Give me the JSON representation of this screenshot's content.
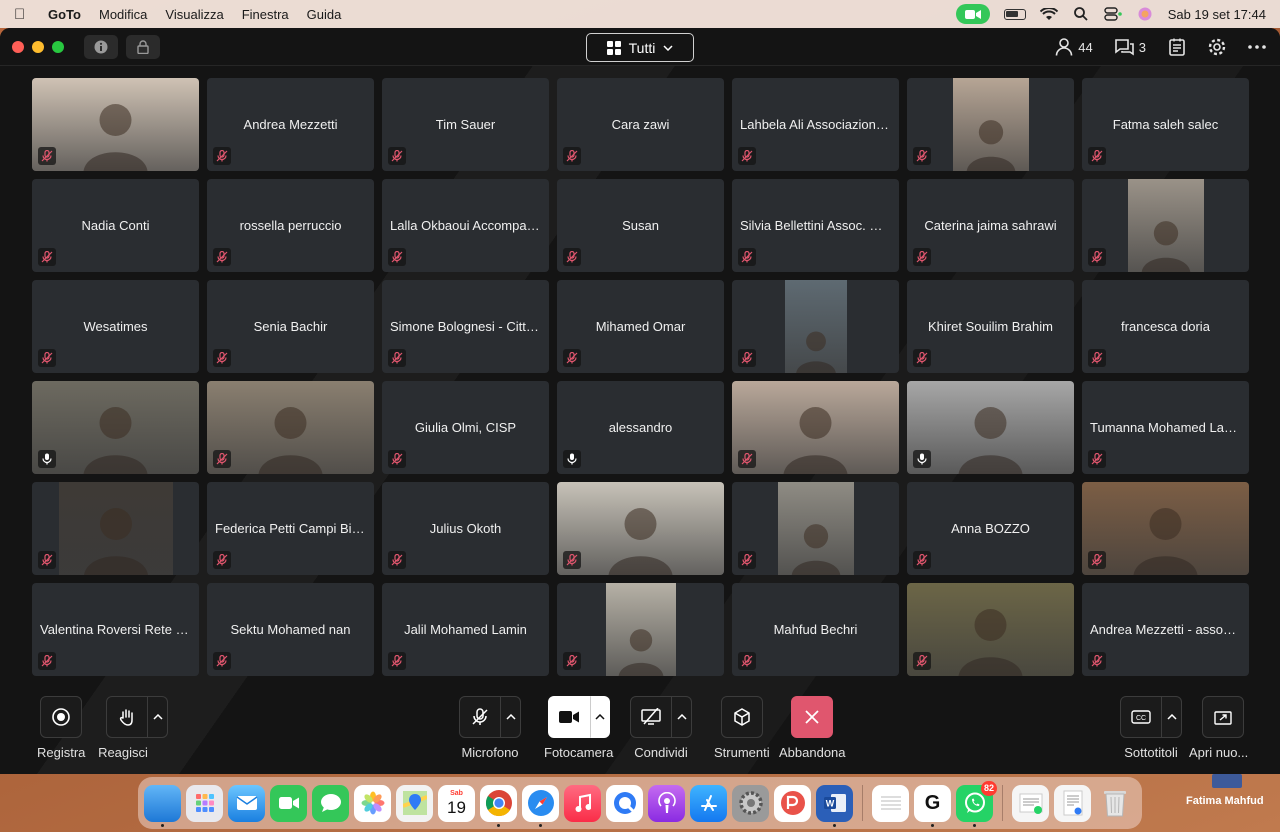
{
  "menubar": {
    "app": "GoTo",
    "menus": [
      "Modifica",
      "Visualizza",
      "Finestra",
      "Guida"
    ],
    "datetime": "Sab 19 set  17:44"
  },
  "titlebar": {
    "view_label": "Tutti",
    "participants_count": "44",
    "chat_count": "3"
  },
  "tiles": [
    {
      "name": "",
      "video": true,
      "mic": "muted",
      "bg": "#cfc2b4",
      "vw": 167
    },
    {
      "name": "Andrea Mezzetti",
      "mic": "muted"
    },
    {
      "name": "Tim Sauer",
      "mic": "muted"
    },
    {
      "name": "Cara zawi",
      "mic": "muted"
    },
    {
      "name": "Lahbela Ali Associazione...",
      "mic": "muted"
    },
    {
      "name": "",
      "video": true,
      "mic": "muted",
      "bg": "#b6a595",
      "vw": 76
    },
    {
      "name": "Fatma saleh salec",
      "mic": "muted"
    },
    {
      "name": "Nadia Conti",
      "mic": "muted"
    },
    {
      "name": "rossella perruccio",
      "mic": "muted"
    },
    {
      "name": "Lalla Okbaoui Accompag...",
      "mic": "muted"
    },
    {
      "name": "Susan",
      "mic": "muted"
    },
    {
      "name": "Silvia Bellettini Assoc. Ka...",
      "mic": "muted"
    },
    {
      "name": "Caterina jaima sahrawi",
      "mic": "muted"
    },
    {
      "name": "",
      "video": true,
      "mic": "muted",
      "bg": "#9a9288",
      "vw": 76
    },
    {
      "name": "Wesatimes",
      "mic": "muted"
    },
    {
      "name": "Senia Bachir",
      "mic": "muted"
    },
    {
      "name": "Simone Bolognesi - Città...",
      "mic": "muted"
    },
    {
      "name": "Mihamed Omar",
      "mic": "muted"
    },
    {
      "name": "",
      "video": true,
      "mic": "muted",
      "bg": "#5e6a72",
      "vw": 62
    },
    {
      "name": "Khiret Souilim Brahim",
      "mic": "muted"
    },
    {
      "name": "francesca doria",
      "mic": "muted"
    },
    {
      "name": "",
      "video": true,
      "mic": "on",
      "bg": "#6d6a60",
      "vw": 167
    },
    {
      "name": "",
      "video": true,
      "mic": "muted",
      "bg": "#8a7f70",
      "vw": 167
    },
    {
      "name": "Giulia Olmi, CISP",
      "mic": "muted"
    },
    {
      "name": "alessandro",
      "mic": "on"
    },
    {
      "name": "",
      "video": true,
      "mic": "muted",
      "bg": "#b9a89a",
      "vw": 167
    },
    {
      "name": "",
      "video": true,
      "mic": "on",
      "bg": "#a7a7a7",
      "vw": 167
    },
    {
      "name": "Tumanna Mohamed Lamin",
      "mic": "muted"
    },
    {
      "name": "",
      "video": true,
      "mic": "muted",
      "bg": "#3e3a36",
      "vw": 114
    },
    {
      "name": "Federica Petti Campi Bis...",
      "mic": "muted"
    },
    {
      "name": "Julius Okoth",
      "mic": "muted"
    },
    {
      "name": "",
      "video": true,
      "mic": "muted",
      "bg": "#c7c2b8",
      "vw": 167
    },
    {
      "name": "",
      "video": true,
      "mic": "muted",
      "bg": "#8f8c84",
      "vw": 76
    },
    {
      "name": "Anna BOZZO",
      "mic": "muted"
    },
    {
      "name": "",
      "video": true,
      "mic": "muted",
      "bg": "#7c5e45",
      "vw": 167
    },
    {
      "name": "Valentina Roversi Rete S...",
      "mic": "muted"
    },
    {
      "name": "Sektu Mohamed nan",
      "mic": "muted"
    },
    {
      "name": "Jalil Mohamed Lamin",
      "mic": "muted"
    },
    {
      "name": "",
      "video": true,
      "mic": "muted",
      "bg": "#b6b1a6",
      "vw": 70
    },
    {
      "name": "Mahfud Bechri",
      "mic": "muted"
    },
    {
      "name": "",
      "video": true,
      "mic": "muted",
      "bg": "#6c6647",
      "vw": 167
    },
    {
      "name": "Andrea Mezzetti - associ...",
      "mic": "muted"
    }
  ],
  "toolbar": {
    "record": "Registra",
    "react": "Reagisci",
    "mic": "Microfono",
    "camera": "Fotocamera",
    "share": "Condividi",
    "tools": "Strumenti",
    "leave": "Abbandona",
    "captions": "Sottotitoli",
    "open_new": "Apri nuo..."
  },
  "dock": {
    "calendar_month": "Sab",
    "calendar_day": "19",
    "whatsapp_badge": "82"
  },
  "desktop": {
    "folder_label": "Fatima Mahfud"
  },
  "colors": {
    "window_bg": "#141414",
    "tile_bg": "#2a2d31",
    "muted_icon": "#e0566e",
    "leave_button": "#e0566e",
    "camera_indicator": "#34c759"
  }
}
